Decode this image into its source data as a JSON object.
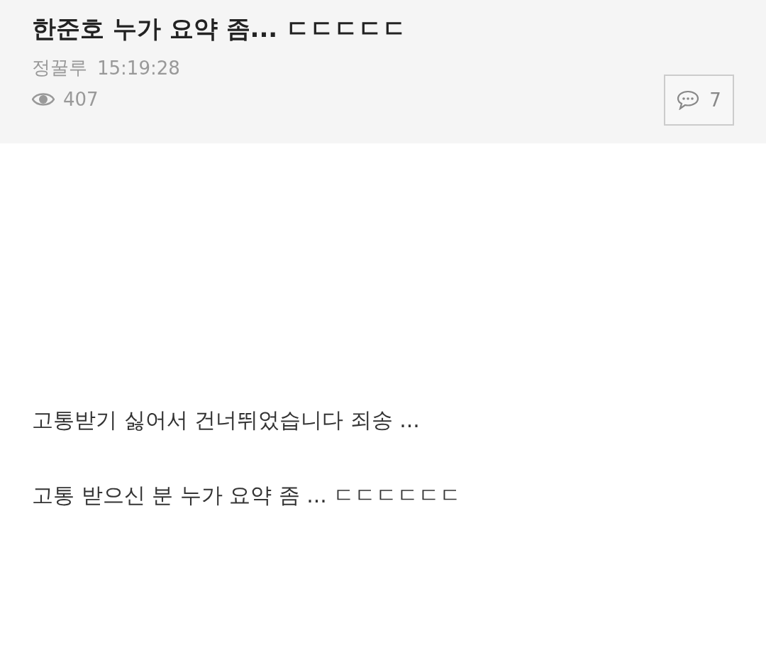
{
  "post": {
    "title": "한준호 누가 요약 좀... ㄷㄷㄷㄷㄷ",
    "author": "정꿀루",
    "time": "15:19:28",
    "views": "407",
    "comments": "7"
  },
  "body": [
    "고통받기 싫어서 건너뛰었습니다 죄송 ...",
    "고통 받으신 분 누가 요약 좀 ... ㄷㄷㄷㄷㄷㄷ"
  ]
}
